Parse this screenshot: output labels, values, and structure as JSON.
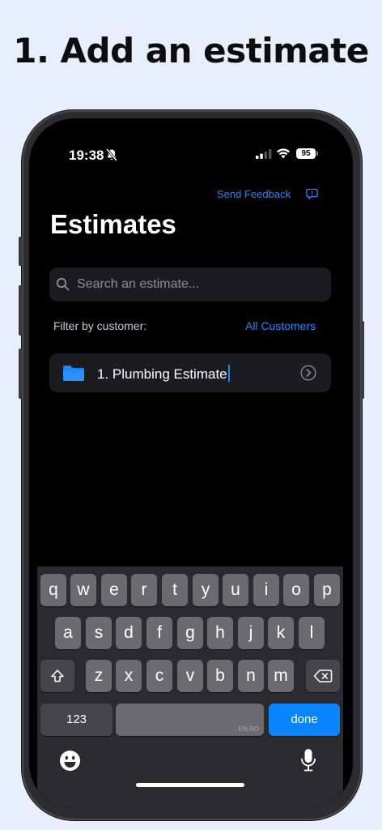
{
  "headline": "1. Add an estimate",
  "status_bar": {
    "time": "19:38",
    "battery": "95"
  },
  "header": {
    "feedback_label": "Send Feedback",
    "title": "Estimates"
  },
  "search": {
    "placeholder": "Search an estimate..."
  },
  "filter": {
    "label": "Filter by customer:",
    "value": "All Customers"
  },
  "estimates": [
    {
      "name": "1. Plumbing Estimate"
    }
  ],
  "keyboard": {
    "row1": [
      "q",
      "w",
      "e",
      "r",
      "t",
      "y",
      "u",
      "i",
      "o",
      "p"
    ],
    "row2": [
      "a",
      "s",
      "d",
      "f",
      "g",
      "h",
      "j",
      "k",
      "l"
    ],
    "row3": [
      "z",
      "x",
      "c",
      "v",
      "b",
      "n",
      "m"
    ],
    "numbers_label": "123",
    "space_hint": "EN RO",
    "done_label": "done"
  },
  "colors": {
    "accent": "#1f86ff",
    "done_button": "#0a84ff",
    "background": "#e7effd"
  },
  "icons": [
    "bell-slash-icon",
    "signal-icon",
    "wifi-icon",
    "feedback-icon",
    "search-icon",
    "folder-icon",
    "chevron-right-icon",
    "shift-icon",
    "delete-icon",
    "emoji-icon",
    "microphone-icon"
  ]
}
